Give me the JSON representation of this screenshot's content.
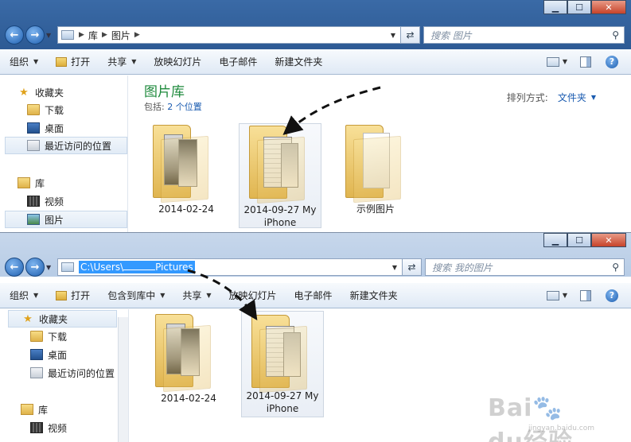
{
  "top_window": {
    "address": {
      "crumbs": [
        "库",
        "图片"
      ]
    },
    "search": {
      "placeholder": "搜索 图片"
    },
    "toolbar": {
      "items": [
        "组织",
        "打开",
        "共享",
        "放映幻灯片",
        "电子邮件",
        "新建文件夹"
      ]
    },
    "nav_items": [
      "收藏夹",
      "下载",
      "桌面",
      "最近访问的位置",
      "库",
      "视频",
      "图片"
    ],
    "library": {
      "title": "图片库",
      "includes_label": "包括:",
      "includes_link": "2 个位置",
      "arrange_label": "排列方式:",
      "arrange_value": "文件夹"
    },
    "files": [
      {
        "name": "2014-02-24"
      },
      {
        "name_line1": "2014-09-27 My",
        "name_line2": "iPhone"
      },
      {
        "name": "示例图片"
      }
    ]
  },
  "bottom_window": {
    "address": {
      "path_prefix": "C:\\Users\\",
      "path_suffix": "Pictures"
    },
    "search": {
      "placeholder": "搜索 我的图片"
    },
    "toolbar": {
      "items": [
        "组织",
        "打开",
        "包含到库中",
        "共享",
        "放映幻灯片",
        "电子邮件",
        "新建文件夹"
      ]
    },
    "nav_items": [
      "收藏夹",
      "下载",
      "桌面",
      "最近访问的位置",
      "库",
      "视频"
    ],
    "files": [
      {
        "name": "2014-02-24"
      },
      {
        "name_line1": "2014-09-27 My",
        "name_line2": "iPhone"
      }
    ]
  },
  "caption_glyphs": {
    "minimize": "▁",
    "maximize": "☐",
    "close": "✕"
  },
  "watermark": {
    "brand": "Bai",
    "brand_rest": "du",
    "cn": "经验",
    "url": "jingyan.baidu.com"
  },
  "colors": {
    "library_title": "#1e8a3c",
    "link": "#1a5bb0",
    "selection": "#3399ff"
  }
}
